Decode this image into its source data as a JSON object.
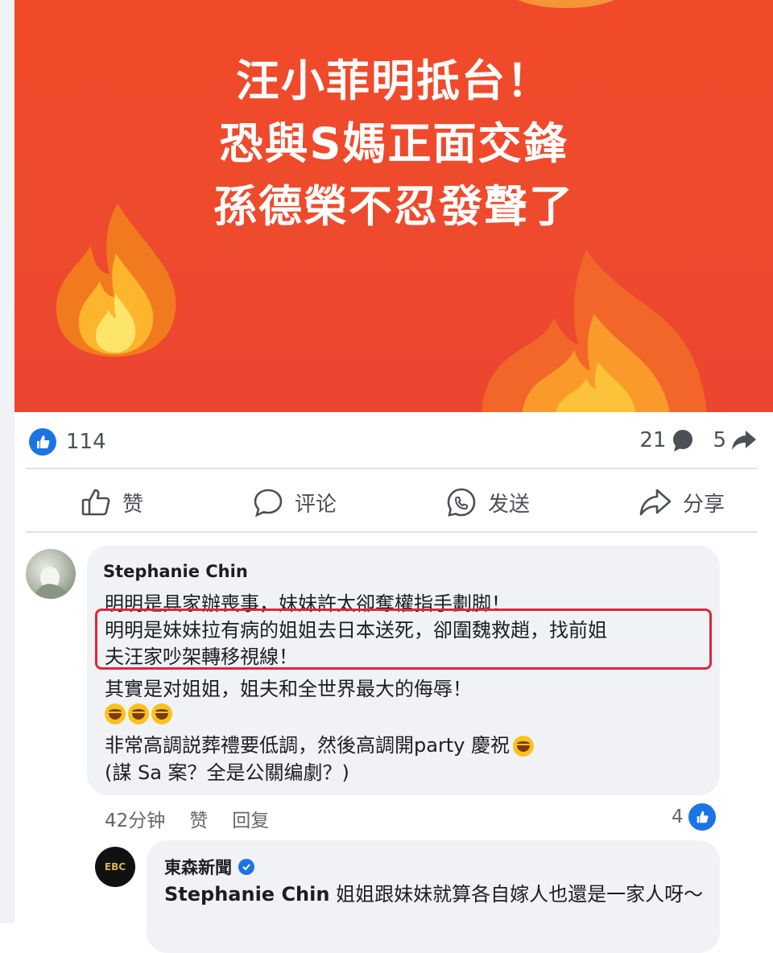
{
  "post": {
    "headline": [
      "汪小菲明抵台！",
      "恐與S媽正面交鋒",
      "孫德榮不忍發聲了"
    ],
    "like_count": "114",
    "comment_count": "21",
    "share_count": "5",
    "colors": {
      "banner": "#ee4a2d",
      "accent": "#1b74e4",
      "highlight": "#e0263d"
    }
  },
  "actions": [
    {
      "label": "赞",
      "icon": "thumbs-up-icon"
    },
    {
      "label": "评论",
      "icon": "comment-icon"
    },
    {
      "label": "发送",
      "icon": "messenger-icon"
    },
    {
      "label": "分享",
      "icon": "share-icon"
    }
  ],
  "comment": {
    "author": "Stephanie Chin",
    "lines": [
      "明明是具家辦喪事，妹妹許太卻奪權指手劃脚！",
      "明明是妹妹拉有病的姐姐去日本送死，卻圍魏救趙，找前姐",
      "夫汪家吵架轉移視線！",
      "其實是对姐姐，姐夫和全世界最大的侮辱！",
      "非常高調説葬禮要低調，然後高調開party 慶祝",
      "(謀 Sa 案？全是公關编劇？)"
    ],
    "time": "42分钟",
    "like_label": "赞",
    "reply_label": "回复",
    "reaction_count": "4"
  },
  "reply": {
    "author": "東森新聞",
    "avatar_text": "EBC",
    "mention": "Stephanie Chin",
    "text": " 姐姐跟妹妹就算各自嫁人也還是一家人呀～"
  }
}
